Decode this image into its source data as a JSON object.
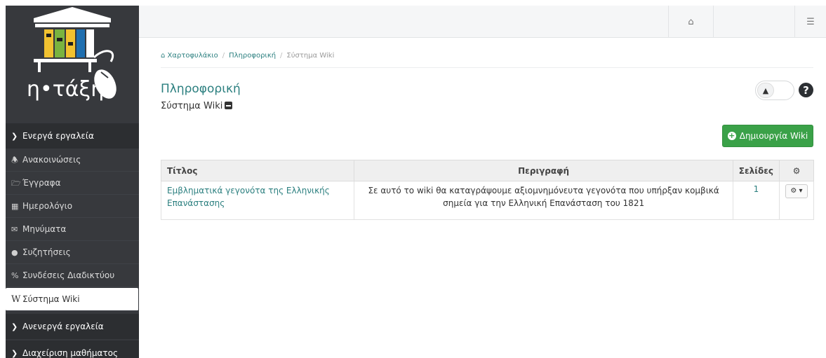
{
  "sidebar": {
    "logo_text": "η•τάξη",
    "active_tools_label": "Ενεργά εργαλεία",
    "items": [
      {
        "label": "Ανακοινώσεις",
        "icon": "megaphone-icon",
        "glyph": "📢"
      },
      {
        "label": "Έγγραφα",
        "icon": "folder-icon",
        "glyph": "🗁"
      },
      {
        "label": "Ημερολόγιο",
        "icon": "calendar-icon",
        "glyph": "📅"
      },
      {
        "label": "Μηνύματα",
        "icon": "envelope-icon",
        "glyph": "✉"
      },
      {
        "label": "Συζητήσεις",
        "icon": "comments-icon",
        "glyph": "💬"
      },
      {
        "label": "Συνδέσεις Διαδικτύου",
        "icon": "link-icon",
        "glyph": "%"
      },
      {
        "label": "Σύστημα Wiki",
        "icon": "wikipedia-icon",
        "glyph": "W"
      }
    ],
    "inactive_tools_label": "Ανενεργά εργαλεία",
    "course_admin_label": "Διαχείριση μαθήματος"
  },
  "topbar": {
    "home_icon": "home-icon",
    "settings_icon": "sliders-icon"
  },
  "breadcrumb": {
    "items": [
      "Χαρτοφυλάκιο",
      "Πληροφορική",
      "Σύστημα Wiki"
    ]
  },
  "page": {
    "title": "Πληροφορική",
    "subtitle": "Σύστημα Wiki"
  },
  "toolbar": {
    "create_label": "Δημιουργία Wiki"
  },
  "table": {
    "headers": {
      "title": "Τίτλος",
      "description": "Περιγραφή",
      "pages": "Σελίδες"
    },
    "rows": [
      {
        "title": "Εμβληματικά γεγονότα της Ελληνικής Επανάστασης",
        "description": "Σε αυτό το wiki θα καταγράψουμε αξιομνημόνευτα γεγονότα που υπήρξαν κομβικά σημεία για την Ελληνική Επανάσταση του 1821",
        "pages": "1"
      }
    ]
  },
  "colors": {
    "accent": "#2b7f7f",
    "sidebar_bg": "#37393d",
    "create_button": "#3aa148"
  }
}
